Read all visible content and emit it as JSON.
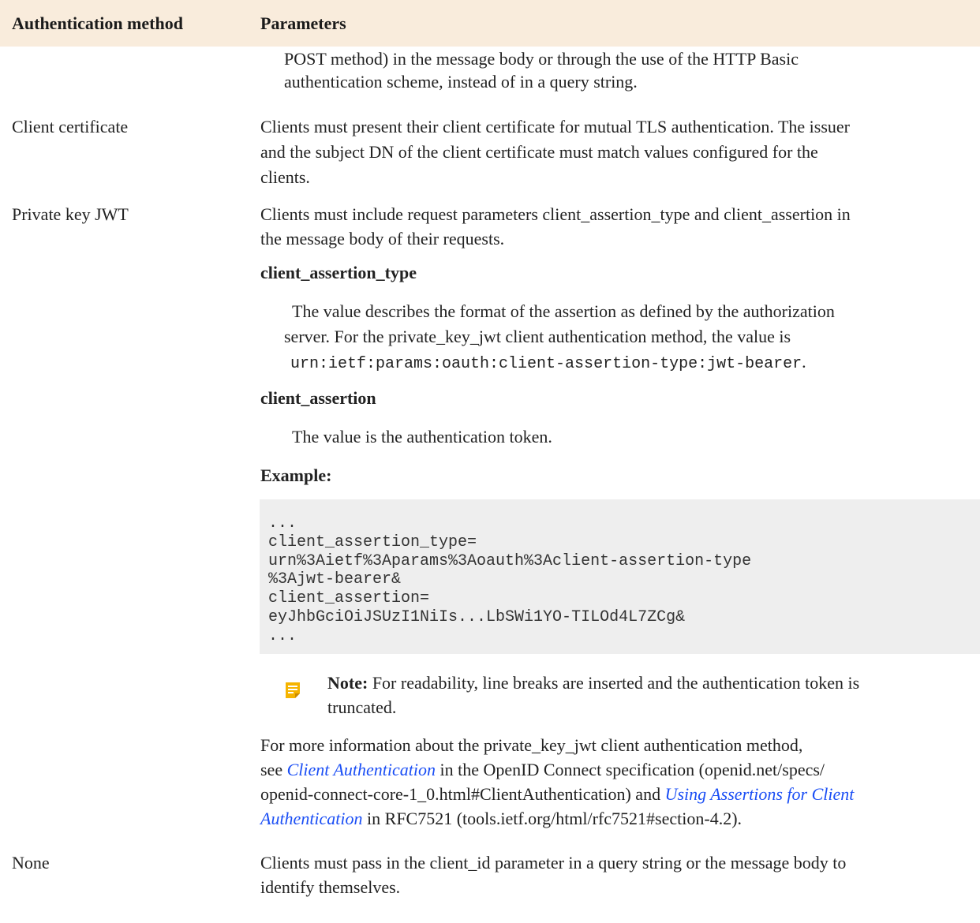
{
  "table": {
    "headers": {
      "method": "Authentication method",
      "parameters": "Parameters"
    },
    "continuation": {
      "line1": "POST method) in the message body or through the use of the HTTP Basic",
      "line2": "authentication scheme, instead of in a query string."
    },
    "client_certificate": {
      "label": "Client certificate",
      "line1": "Clients must present their client certificate for mutual TLS authentication. The issuer",
      "line2": "and the subject DN of the client certificate must match values configured for the",
      "line3": "clients."
    },
    "private_key_jwt": {
      "label": "Private key JWT",
      "intro_line1": "Clients must include request parameters client_assertion_type and client_assertion in",
      "intro_line2": "the message body of their requests.",
      "param1": {
        "name": "client_assertion_type",
        "line1": "The value describes the format of the assertion as defined by the authorization",
        "line2": "server. For the private_key_jwt client authentication method, the value is",
        "code": "urn:ietf:params:oauth:client-assertion-type:jwt-bearer",
        "code_end": "."
      },
      "param2": {
        "name": "client_assertion",
        "line1": "The value is the authentication token."
      },
      "example_label": "Example:",
      "code_lines": [
        "...",
        "client_assertion_type=",
        "urn%3Aietf%3Aparams%3Aoauth%3Aclient-assertion-type",
        "%3Ajwt-bearer&",
        "client_assertion=",
        "eyJhbGciOiJSUzI1NiIs...LbSWi1YO-TILOd4L7ZCg&",
        "..."
      ],
      "note": {
        "icon": "note-icon",
        "label": "Note:",
        "line1": "For readability, line breaks are inserted and the authentication token is",
        "line2": "truncated."
      },
      "more": {
        "line1": "For more information about the private_key_jwt client authentication method,",
        "line2_prefix": "see ",
        "link1": "Client Authentication",
        "line2_suffix": " in the OpenID Connect specification (openid.net/specs/",
        "line3_prefix": "openid-connect-core-1_0.html#ClientAuthentication) and ",
        "link2a": "Using Assertions for Client",
        "link2b": "Authentication",
        "line4_suffix": " in RFC7521 (tools.ietf.org/html/rfc7521#section-4.2)."
      }
    },
    "none": {
      "label": "None",
      "line1": "Clients must pass in the client_id parameter in a query string or the message body to",
      "line2": "identify themselves."
    }
  },
  "colors": {
    "header_bg": "#f9ecdc",
    "code_bg": "#eeeeee",
    "link": "#1a4ef5",
    "note_icon": "#f5b400"
  }
}
